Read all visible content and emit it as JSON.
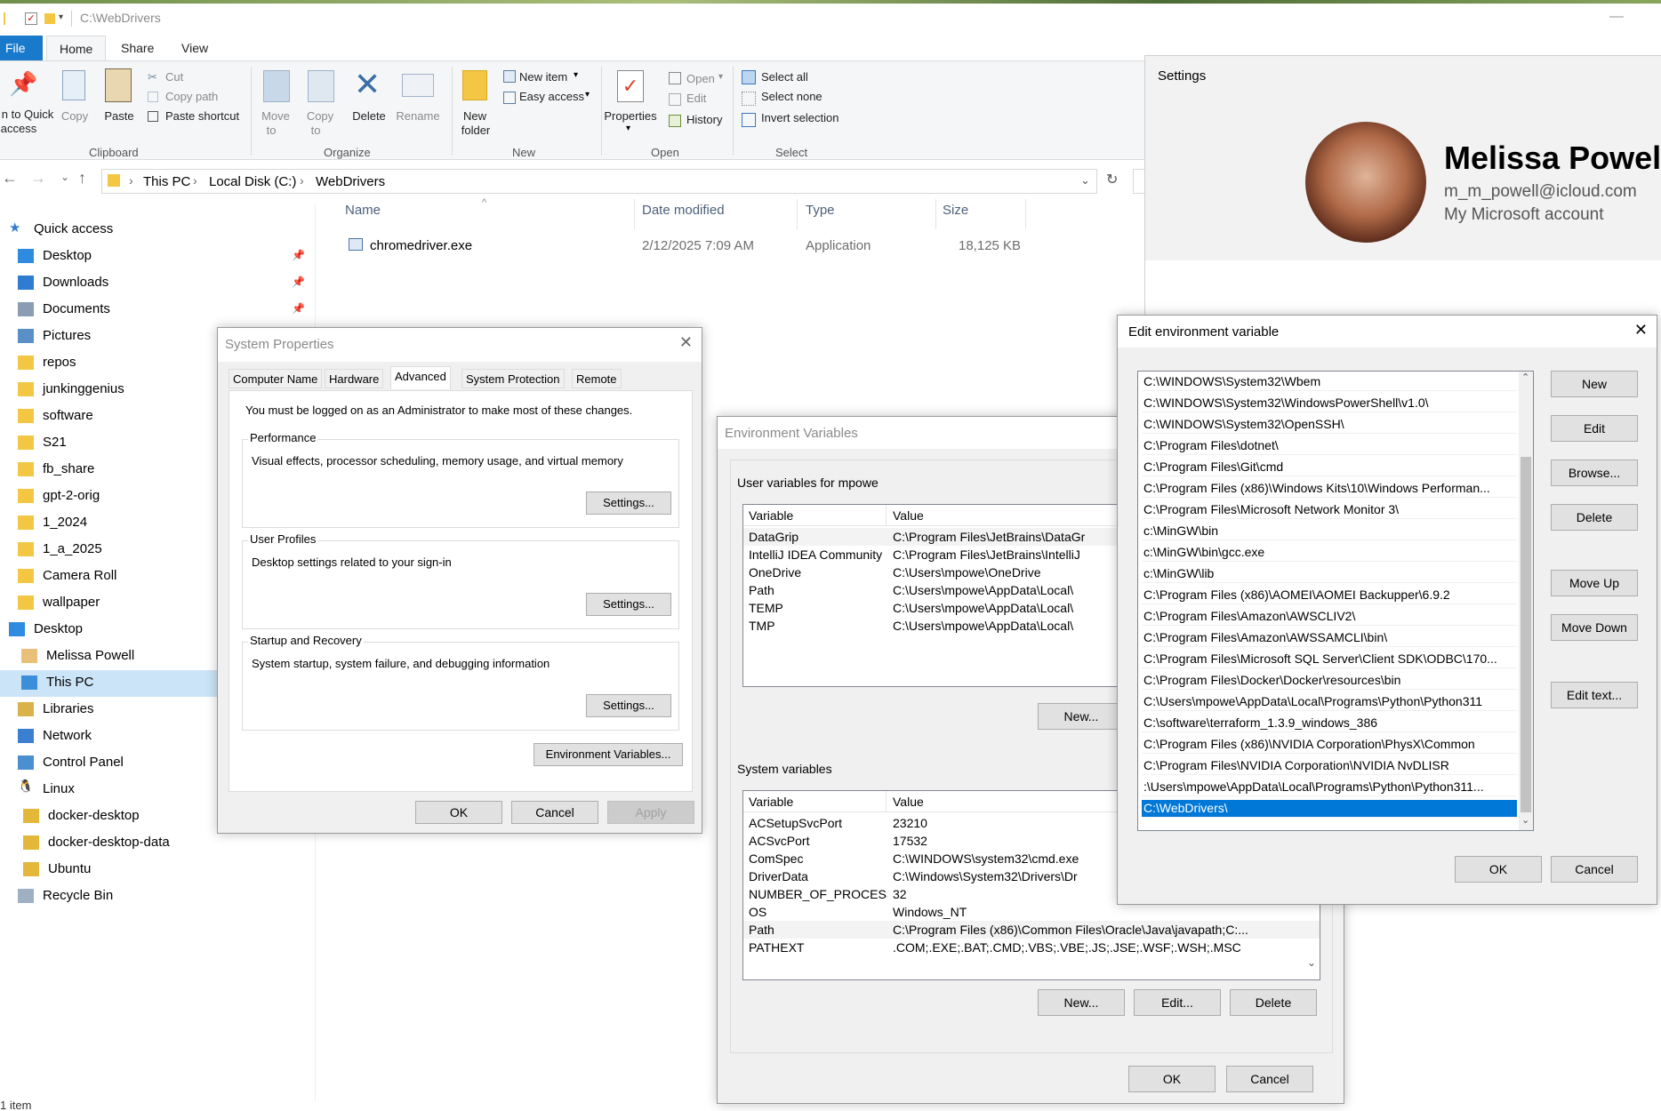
{
  "window": {
    "path_title": "C:\\WebDrivers"
  },
  "ribbon": {
    "tabs": {
      "file": "File",
      "home": "Home",
      "share": "Share",
      "view": "View"
    },
    "clipboard": {
      "pin": "n to Quick",
      "pin2": "access",
      "copy": "Copy",
      "paste": "Paste",
      "cut": "Cut",
      "copy_path": "Copy path",
      "paste_shortcut": "Paste shortcut",
      "group": "Clipboard"
    },
    "organize": {
      "move_to": "Move",
      "move_to2": "to",
      "copy_to": "Copy",
      "copy_to2": "to",
      "delete": "Delete",
      "rename": "Rename",
      "group": "Organize"
    },
    "new": {
      "new_folder": "New",
      "new_folder2": "folder",
      "new_item": "New item",
      "easy_access": "Easy access",
      "group": "New"
    },
    "open": {
      "properties": "Properties",
      "open": "Open",
      "edit": "Edit",
      "history": "History",
      "group": "Open"
    },
    "select": {
      "select_all": "Select all",
      "select_none": "Select none",
      "invert": "Invert selection",
      "group": "Select"
    }
  },
  "address": {
    "crumbs": [
      "This PC",
      "Local Disk (C:)",
      "WebDrivers"
    ]
  },
  "nav": [
    {
      "label": "Quick access",
      "icon": "star-icon"
    },
    {
      "label": "Desktop",
      "icon": "desktop-icon",
      "pinned": true
    },
    {
      "label": "Downloads",
      "icon": "download-icon",
      "pinned": true
    },
    {
      "label": "Documents",
      "icon": "documents-icon",
      "pinned": true
    },
    {
      "label": "Pictures",
      "icon": "pictures-icon"
    },
    {
      "label": "repos",
      "icon": "folder-icon"
    },
    {
      "label": "junkinggenius",
      "icon": "folder-icon"
    },
    {
      "label": "software",
      "icon": "folder-icon"
    },
    {
      "label": "S21",
      "icon": "folder-icon"
    },
    {
      "label": "fb_share",
      "icon": "folder-icon"
    },
    {
      "label": "gpt-2-orig",
      "icon": "folder-icon"
    },
    {
      "label": "1_2024",
      "icon": "folder-icon"
    },
    {
      "label": "1_a_2025",
      "icon": "folder-icon"
    },
    {
      "label": "Camera Roll",
      "icon": "folder-icon"
    },
    {
      "label": "wallpaper",
      "icon": "folder-icon"
    },
    {
      "label": "Desktop",
      "icon": "desktop-icon"
    },
    {
      "label": "Melissa Powell",
      "icon": "user-icon"
    },
    {
      "label": "This PC",
      "icon": "pc-icon"
    },
    {
      "label": "Libraries",
      "icon": "libraries-icon"
    },
    {
      "label": "Network",
      "icon": "network-icon"
    },
    {
      "label": "Control Panel",
      "icon": "control-panel-icon"
    },
    {
      "label": "Linux",
      "icon": "linux-icon"
    },
    {
      "label": "docker-desktop",
      "icon": "drive-icon"
    },
    {
      "label": "docker-desktop-data",
      "icon": "drive-icon"
    },
    {
      "label": "Ubuntu",
      "icon": "drive-icon"
    },
    {
      "label": "Recycle Bin",
      "icon": "recycle-bin-icon"
    }
  ],
  "files": {
    "headers": {
      "name": "Name",
      "date": "Date modified",
      "type": "Type",
      "size": "Size"
    },
    "rows": [
      {
        "name": "chromedriver.exe",
        "date": "2/12/2025 7:09 AM",
        "type": "Application",
        "size": "18,125 KB"
      }
    ]
  },
  "status": "1 item",
  "settings": {
    "title": "Settings",
    "name": "Melissa Powell",
    "email": "m_m_powell@icloud.com",
    "account": "My Microsoft account"
  },
  "sysprops": {
    "title": "System Properties",
    "tabs": [
      "Computer Name",
      "Hardware",
      "Advanced",
      "System Protection",
      "Remote"
    ],
    "admin_note": "You must be logged on as an Administrator to make most of these changes.",
    "perf_cap": "Performance",
    "perf_desc": "Visual effects, processor scheduling, memory usage, and virtual memory",
    "profiles_cap": "User Profiles",
    "profiles_desc": "Desktop settings related to your sign-in",
    "startup_cap": "Startup and Recovery",
    "startup_desc": "System startup, system failure, and debugging information",
    "settings_btn": "Settings...",
    "env_btn": "Environment Variables...",
    "ok": "OK",
    "cancel": "Cancel",
    "apply": "Apply"
  },
  "envvars": {
    "title": "Environment Variables",
    "user_cap": "User variables for mpowe",
    "col_var": "Variable",
    "col_val": "Value",
    "user_rows": [
      {
        "var": "DataGrip",
        "val": "C:\\Program Files\\JetBrains\\DataGr"
      },
      {
        "var": "IntelliJ IDEA Community E...",
        "val": "C:\\Program Files\\JetBrains\\IntelliJ"
      },
      {
        "var": "OneDrive",
        "val": "C:\\Users\\mpowe\\OneDrive"
      },
      {
        "var": "Path",
        "val": "C:\\Users\\mpowe\\AppData\\Local\\"
      },
      {
        "var": "TEMP",
        "val": "C:\\Users\\mpowe\\AppData\\Local\\"
      },
      {
        "var": "TMP",
        "val": "C:\\Users\\mpowe\\AppData\\Local\\"
      }
    ],
    "sys_cap": "System variables",
    "sys_rows": [
      {
        "var": "ACSetupSvcPort",
        "val": "23210"
      },
      {
        "var": "ACSvcPort",
        "val": "17532"
      },
      {
        "var": "ComSpec",
        "val": "C:\\WINDOWS\\system32\\cmd.exe"
      },
      {
        "var": "DriverData",
        "val": "C:\\Windows\\System32\\Drivers\\Dr"
      },
      {
        "var": "NUMBER_OF_PROCESSORS",
        "val": "32"
      },
      {
        "var": "OS",
        "val": "Windows_NT"
      },
      {
        "var": "Path",
        "val": "C:\\Program Files (x86)\\Common Files\\Oracle\\Java\\javapath;C:..."
      },
      {
        "var": "PATHEXT",
        "val": ".COM;.EXE;.BAT;.CMD;.VBS;.VBE;.JS;.JSE;.WSF;.WSH;.MSC"
      }
    ],
    "new": "New...",
    "edit": "Edit...",
    "delete": "Delete",
    "ok": "OK",
    "cancel": "Cancel"
  },
  "editenv": {
    "title": "Edit environment variable",
    "paths": [
      "C:\\WINDOWS\\System32\\Wbem",
      "C:\\WINDOWS\\System32\\WindowsPowerShell\\v1.0\\",
      "C:\\WINDOWS\\System32\\OpenSSH\\",
      "C:\\Program Files\\dotnet\\",
      "C:\\Program Files\\Git\\cmd",
      "C:\\Program Files (x86)\\Windows Kits\\10\\Windows Performan...",
      "C:\\Program Files\\Microsoft Network Monitor 3\\",
      "c:\\MinGW\\bin",
      "c:\\MinGW\\bin\\gcc.exe",
      "c:\\MinGW\\lib",
      "C:\\Program Files (x86)\\AOMEI\\AOMEI Backupper\\6.9.2",
      "C:\\Program Files\\Amazon\\AWSCLIV2\\",
      "C:\\Program Files\\Amazon\\AWSSAMCLI\\bin\\",
      "C:\\Program Files\\Microsoft SQL Server\\Client SDK\\ODBC\\170...",
      "C:\\Program Files\\Docker\\Docker\\resources\\bin",
      "C:\\Users\\mpowe\\AppData\\Local\\Programs\\Python\\Python311",
      "C:\\software\\terraform_1.3.9_windows_386",
      "C:\\Program Files (x86)\\NVIDIA Corporation\\PhysX\\Common",
      "C:\\Program Files\\NVIDIA Corporation\\NVIDIA NvDLISR",
      ":\\Users\\mpowe\\AppData\\Local\\Programs\\Python\\Python311...",
      "C:\\WebDrivers\\"
    ],
    "new": "New",
    "edit": "Edit",
    "browse": "Browse...",
    "delete": "Delete",
    "move_up": "Move Up",
    "move_down": "Move Down",
    "edit_text": "Edit text...",
    "ok": "OK",
    "cancel": "Cancel"
  }
}
